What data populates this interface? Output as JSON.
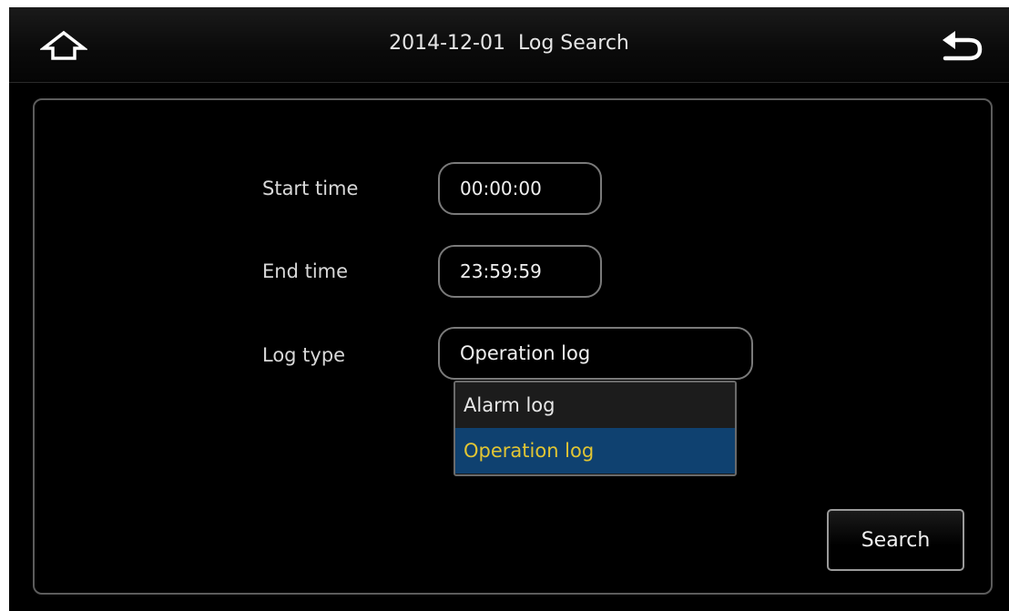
{
  "header": {
    "date": "2014-12-01",
    "title": "Log Search"
  },
  "form": {
    "start_time": {
      "label": "Start time",
      "value": "00:00:00"
    },
    "end_time": {
      "label": "End time",
      "value": "23:59:59"
    },
    "log_type": {
      "label": "Log type",
      "value": "Operation log"
    }
  },
  "dropdown": {
    "options": [
      "Alarm log",
      "Operation log"
    ],
    "selected": "Operation log"
  },
  "buttons": {
    "search_label": "Search"
  },
  "icons": {
    "home": "home-icon",
    "back": "back-arrow-icon"
  },
  "colors": {
    "background": "#000000",
    "selected_bg": "#0f4170",
    "selected_text": "#e1c534"
  }
}
